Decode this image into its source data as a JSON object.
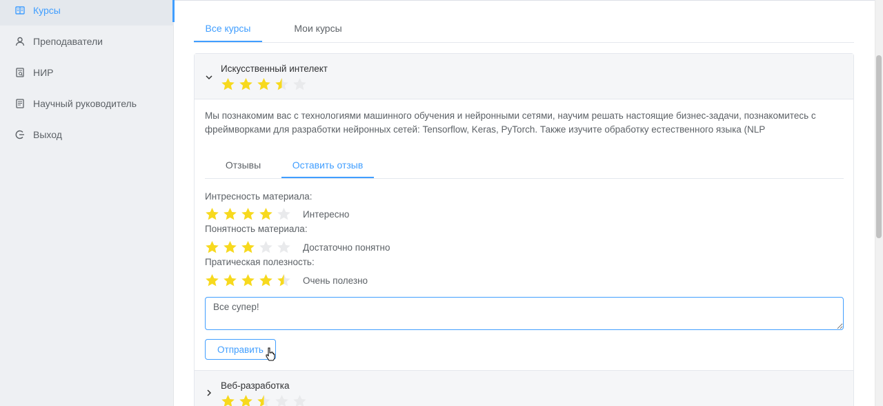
{
  "sidebar": {
    "items": [
      {
        "label": "Курсы",
        "icon": "book-icon",
        "active": true
      },
      {
        "label": "Преподаватели",
        "icon": "user-icon",
        "active": false
      },
      {
        "label": "НИР",
        "icon": "document-search-icon",
        "active": false
      },
      {
        "label": "Научный руководитель",
        "icon": "document-list-icon",
        "active": false
      },
      {
        "label": "Выход",
        "icon": "logout-icon",
        "active": false
      }
    ]
  },
  "tabs": [
    {
      "label": "Все курсы",
      "active": true
    },
    {
      "label": "Мои курсы",
      "active": false
    }
  ],
  "courses": [
    {
      "title": "Искусственный интелект",
      "rating": 3.5,
      "expanded": true,
      "description": "Мы познакомим вас с технологиями машинного обучения и нейронными сетями, научим решать настоящие бизнес-задачи, познакомитесь с фреймворками для разработки нейронных сетей: Tensorflow, Keras, PyTorch. Также изучите обработку естественного языка (NLP"
    },
    {
      "title": "Веб-разработка",
      "rating": 2.5,
      "expanded": false
    }
  ],
  "review_tabs": [
    {
      "label": "Отзывы",
      "active": false
    },
    {
      "label": "Оставить отзыв",
      "active": true
    }
  ],
  "ratings": [
    {
      "label": "Интресность материала:",
      "value": 4,
      "text": "Интересно"
    },
    {
      "label": "Понятность материала:",
      "value": 3,
      "text": "Достаточно понятно"
    },
    {
      "label": "Пратическая полезность:",
      "value": 4.5,
      "text": "Очень полезно"
    }
  ],
  "review_text": "Все супер!",
  "submit_label": "Отправить",
  "colors": {
    "accent": "#409eff",
    "star_on": "#f7d91e",
    "star_off": "#e9eaec"
  }
}
